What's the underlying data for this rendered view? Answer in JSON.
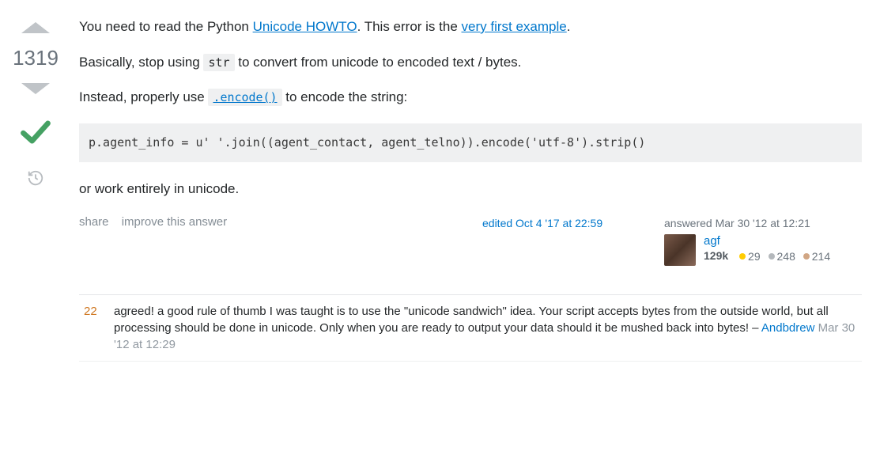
{
  "answer": {
    "vote_score": "1319",
    "body": {
      "p1_prefix": "You need to read the Python ",
      "p1_link1": "Unicode HOWTO",
      "p1_mid": ". This error is the ",
      "p1_link2": "very first example",
      "p1_suffix": ".",
      "p2_prefix": "Basically, stop using ",
      "p2_code": "str",
      "p2_suffix": " to convert from unicode to encoded text / bytes.",
      "p3_prefix": "Instead, properly use ",
      "p3_code_link": ".encode()",
      "p3_suffix": " to encode the string:",
      "code_block": "p.agent_info = u' '.join((agent_contact, agent_telno)).encode('utf-8').strip()",
      "p4": "or work entirely in unicode."
    },
    "menu": {
      "share": "share",
      "improve": "improve this answer"
    },
    "edited": {
      "prefix": "edited ",
      "date": "Oct 4 '17 at 22:59"
    },
    "answered": {
      "prefix": "answered ",
      "date": "Mar 30 '12 at 12:21",
      "author": "agf",
      "reputation": "129k",
      "gold": "29",
      "silver": "248",
      "bronze": "214"
    }
  },
  "comments": [
    {
      "score": "22",
      "text": "agreed! a good rule of thumb I was taught is to use the \"unicode sandwich\" idea. Your script accepts bytes from the outside world, but all processing should be done in unicode. Only when you are ready to output your data should it be mushed back into bytes! – ",
      "author": "Andbdrew",
      "date": "Mar 30 '12 at 12:29"
    }
  ]
}
